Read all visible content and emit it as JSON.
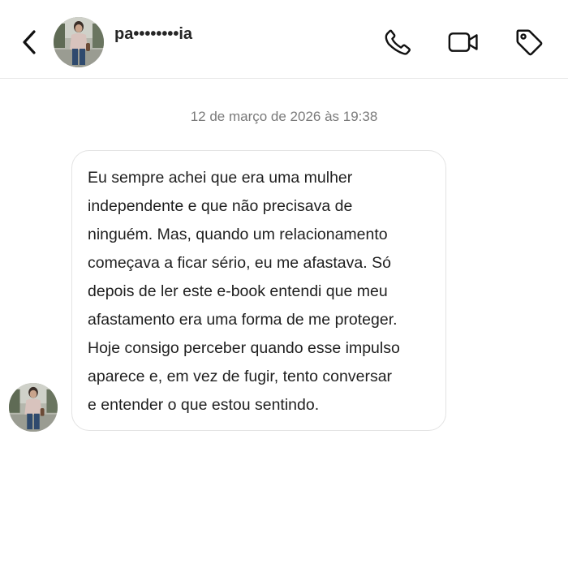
{
  "header": {
    "back_icon": "chevron-left-icon",
    "username": "pa••••••••ia",
    "actions": [
      {
        "name": "audio-call",
        "icon": "phone-icon"
      },
      {
        "name": "video-call",
        "icon": "video-camera-icon"
      },
      {
        "name": "label",
        "icon": "tag-icon"
      }
    ]
  },
  "conversation": {
    "timestamp": "12 de março de 2026 às 19:38",
    "message": {
      "text": "Eu sempre achei que era uma mulher\nindependente e que não precisava de\nninguém. Mas, quando um relacionamento\ncomeçava a ficar sério, eu me afastava. Só\ndepois de ler este e-book entendi que meu\nafastamento era uma forma de me proteger.\nHoje consigo perceber quando esse impulso\naparece e, em vez de fugir, tento conversar\ne entender o que estou sentindo."
    }
  },
  "colors": {
    "text": "#262626",
    "timestamp": "#7a7a7a",
    "bubble_border": "#e3e3e3",
    "divider": "#e6e6e6"
  }
}
